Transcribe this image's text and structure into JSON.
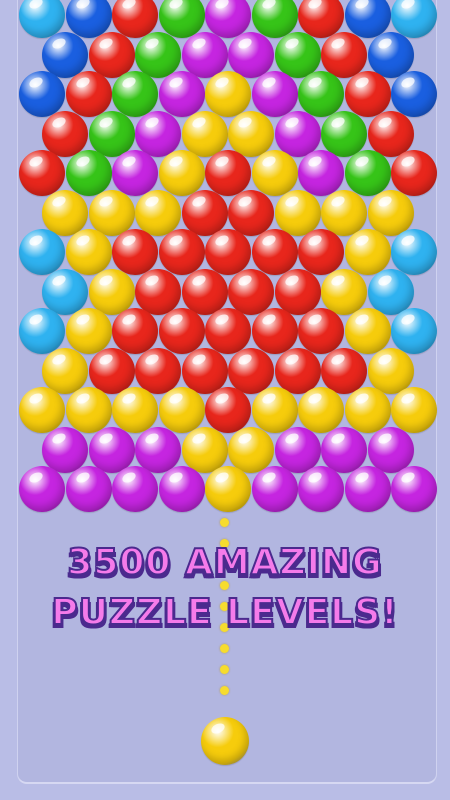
{
  "promo": {
    "line1": "3500 AMAZING",
    "line2": "PUZZLE LEVELS!"
  },
  "colors": {
    "red": "#e8261c",
    "green": "#36c418",
    "blue": "#1a5fe0",
    "cyan": "#2fb2f0",
    "purple": "#c525e0",
    "yellow": "#f6cc0c",
    "background": "#b2b6e0",
    "text_fill": "#f57bea",
    "text_outline": "#4b2a8e",
    "aim_dot": "#f6dc2e"
  },
  "bubble_rows": [
    [
      "cyan",
      "blue",
      "red",
      "green",
      "purple",
      "green",
      "red",
      "blue",
      "cyan"
    ],
    [
      "blue",
      "red",
      "green",
      "purple",
      "purple",
      "green",
      "red",
      "blue"
    ],
    [
      "blue",
      "red",
      "green",
      "purple",
      "yellow",
      "purple",
      "green",
      "red",
      "blue"
    ],
    [
      "red",
      "green",
      "purple",
      "yellow",
      "yellow",
      "purple",
      "green",
      "red"
    ],
    [
      "red",
      "green",
      "purple",
      "yellow",
      "red",
      "yellow",
      "purple",
      "green",
      "red"
    ],
    [
      "yellow",
      "yellow",
      "yellow",
      "red",
      "red",
      "yellow",
      "yellow",
      "yellow"
    ],
    [
      "cyan",
      "yellow",
      "red",
      "red",
      "red",
      "red",
      "red",
      "yellow",
      "cyan"
    ],
    [
      "cyan",
      "yellow",
      "red",
      "red",
      "red",
      "red",
      "yellow",
      "cyan"
    ],
    [
      "cyan",
      "yellow",
      "red",
      "red",
      "red",
      "red",
      "red",
      "yellow",
      "cyan"
    ],
    [
      "yellow",
      "red",
      "red",
      "red",
      "red",
      "red",
      "red",
      "yellow"
    ],
    [
      "yellow",
      "yellow",
      "yellow",
      "yellow",
      "red",
      "yellow",
      "yellow",
      "yellow",
      "yellow"
    ],
    [
      "purple",
      "purple",
      "purple",
      "yellow",
      "yellow",
      "purple",
      "purple",
      "purple"
    ],
    [
      "purple",
      "purple",
      "purple",
      "purple",
      "yellow",
      "purple",
      "purple",
      "purple",
      "purple"
    ]
  ],
  "shooter": {
    "color": "yellow"
  },
  "aim_line": {
    "dot_count": 9
  }
}
